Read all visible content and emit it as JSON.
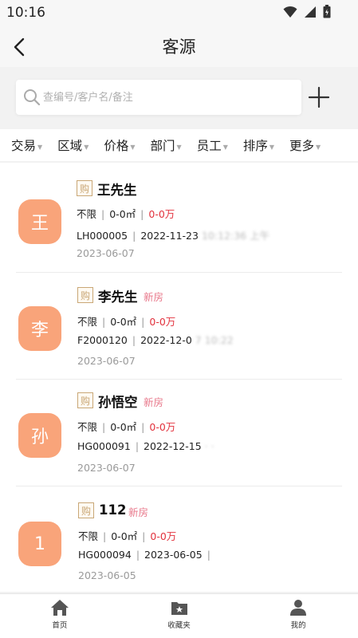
{
  "status_bar": {
    "time": "10:16"
  },
  "header": {
    "title": "客源"
  },
  "search": {
    "placeholder": "查编号/客户名/备注"
  },
  "filters": [
    {
      "label": "交易"
    },
    {
      "label": "区域"
    },
    {
      "label": "价格"
    },
    {
      "label": "部门"
    },
    {
      "label": "员工"
    },
    {
      "label": "排序"
    },
    {
      "label": "更多"
    }
  ],
  "clients": [
    {
      "avatar": "王",
      "badge": "购",
      "name": "王先生",
      "tag": "",
      "type": "不限",
      "area": "0-0㎡",
      "price": "0-0万",
      "code": "LH000005",
      "updated": "2022-11-23",
      "extra": "10:12:36 上午",
      "date": "2023-06-07"
    },
    {
      "avatar": "李",
      "badge": "购",
      "name": "李先生",
      "tag": "新房",
      "type": "不限",
      "area": "0-0㎡",
      "price": "0-0万",
      "code": "F2000120",
      "updated": "2022-12-0",
      "extra": "7 10:22",
      "date": "2023-06-07"
    },
    {
      "avatar": "孙",
      "badge": "购",
      "name": "孙悟空",
      "tag": "新房",
      "type": "不限",
      "area": "0-0㎡",
      "price": "0-0万",
      "code": "HG000091",
      "updated": "2022-12-15",
      "extra": "· ·",
      "date": "2023-06-07"
    },
    {
      "avatar": "1",
      "badge": "购",
      "name": "112",
      "tag": "新房",
      "type": "不限",
      "area": "0-0㎡",
      "price": "0-0万",
      "code": "HG000094",
      "updated": "2023-06-05",
      "extra": "",
      "date": "2023-06-05"
    }
  ],
  "tabbar": [
    {
      "label": "首页",
      "icon": "home-icon"
    },
    {
      "label": "收藏夹",
      "icon": "favorites-folder-icon"
    },
    {
      "label": "我的",
      "icon": "user-icon"
    }
  ],
  "colors": {
    "avatar": "#f9a47a",
    "price": "#e2323d",
    "new_tag": "#e8788b",
    "badge": "#c9a776"
  }
}
